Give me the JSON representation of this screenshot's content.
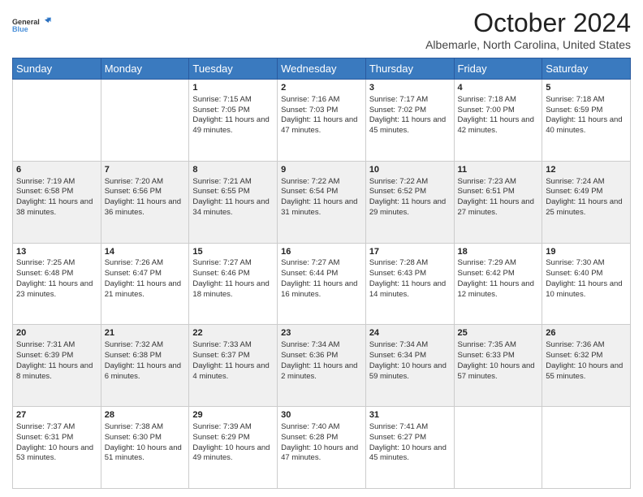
{
  "logo": {
    "line1": "General",
    "line2": "Blue"
  },
  "title": "October 2024",
  "location": "Albemarle, North Carolina, United States",
  "weekdays": [
    "Sunday",
    "Monday",
    "Tuesday",
    "Wednesday",
    "Thursday",
    "Friday",
    "Saturday"
  ],
  "weeks": [
    [
      {
        "day": "",
        "sunrise": "",
        "sunset": "",
        "daylight": ""
      },
      {
        "day": "",
        "sunrise": "",
        "sunset": "",
        "daylight": ""
      },
      {
        "day": "1",
        "sunrise": "Sunrise: 7:15 AM",
        "sunset": "Sunset: 7:05 PM",
        "daylight": "Daylight: 11 hours and 49 minutes."
      },
      {
        "day": "2",
        "sunrise": "Sunrise: 7:16 AM",
        "sunset": "Sunset: 7:03 PM",
        "daylight": "Daylight: 11 hours and 47 minutes."
      },
      {
        "day": "3",
        "sunrise": "Sunrise: 7:17 AM",
        "sunset": "Sunset: 7:02 PM",
        "daylight": "Daylight: 11 hours and 45 minutes."
      },
      {
        "day": "4",
        "sunrise": "Sunrise: 7:18 AM",
        "sunset": "Sunset: 7:00 PM",
        "daylight": "Daylight: 11 hours and 42 minutes."
      },
      {
        "day": "5",
        "sunrise": "Sunrise: 7:18 AM",
        "sunset": "Sunset: 6:59 PM",
        "daylight": "Daylight: 11 hours and 40 minutes."
      }
    ],
    [
      {
        "day": "6",
        "sunrise": "Sunrise: 7:19 AM",
        "sunset": "Sunset: 6:58 PM",
        "daylight": "Daylight: 11 hours and 38 minutes."
      },
      {
        "day": "7",
        "sunrise": "Sunrise: 7:20 AM",
        "sunset": "Sunset: 6:56 PM",
        "daylight": "Daylight: 11 hours and 36 minutes."
      },
      {
        "day": "8",
        "sunrise": "Sunrise: 7:21 AM",
        "sunset": "Sunset: 6:55 PM",
        "daylight": "Daylight: 11 hours and 34 minutes."
      },
      {
        "day": "9",
        "sunrise": "Sunrise: 7:22 AM",
        "sunset": "Sunset: 6:54 PM",
        "daylight": "Daylight: 11 hours and 31 minutes."
      },
      {
        "day": "10",
        "sunrise": "Sunrise: 7:22 AM",
        "sunset": "Sunset: 6:52 PM",
        "daylight": "Daylight: 11 hours and 29 minutes."
      },
      {
        "day": "11",
        "sunrise": "Sunrise: 7:23 AM",
        "sunset": "Sunset: 6:51 PM",
        "daylight": "Daylight: 11 hours and 27 minutes."
      },
      {
        "day": "12",
        "sunrise": "Sunrise: 7:24 AM",
        "sunset": "Sunset: 6:49 PM",
        "daylight": "Daylight: 11 hours and 25 minutes."
      }
    ],
    [
      {
        "day": "13",
        "sunrise": "Sunrise: 7:25 AM",
        "sunset": "Sunset: 6:48 PM",
        "daylight": "Daylight: 11 hours and 23 minutes."
      },
      {
        "day": "14",
        "sunrise": "Sunrise: 7:26 AM",
        "sunset": "Sunset: 6:47 PM",
        "daylight": "Daylight: 11 hours and 21 minutes."
      },
      {
        "day": "15",
        "sunrise": "Sunrise: 7:27 AM",
        "sunset": "Sunset: 6:46 PM",
        "daylight": "Daylight: 11 hours and 18 minutes."
      },
      {
        "day": "16",
        "sunrise": "Sunrise: 7:27 AM",
        "sunset": "Sunset: 6:44 PM",
        "daylight": "Daylight: 11 hours and 16 minutes."
      },
      {
        "day": "17",
        "sunrise": "Sunrise: 7:28 AM",
        "sunset": "Sunset: 6:43 PM",
        "daylight": "Daylight: 11 hours and 14 minutes."
      },
      {
        "day": "18",
        "sunrise": "Sunrise: 7:29 AM",
        "sunset": "Sunset: 6:42 PM",
        "daylight": "Daylight: 11 hours and 12 minutes."
      },
      {
        "day": "19",
        "sunrise": "Sunrise: 7:30 AM",
        "sunset": "Sunset: 6:40 PM",
        "daylight": "Daylight: 11 hours and 10 minutes."
      }
    ],
    [
      {
        "day": "20",
        "sunrise": "Sunrise: 7:31 AM",
        "sunset": "Sunset: 6:39 PM",
        "daylight": "Daylight: 11 hours and 8 minutes."
      },
      {
        "day": "21",
        "sunrise": "Sunrise: 7:32 AM",
        "sunset": "Sunset: 6:38 PM",
        "daylight": "Daylight: 11 hours and 6 minutes."
      },
      {
        "day": "22",
        "sunrise": "Sunrise: 7:33 AM",
        "sunset": "Sunset: 6:37 PM",
        "daylight": "Daylight: 11 hours and 4 minutes."
      },
      {
        "day": "23",
        "sunrise": "Sunrise: 7:34 AM",
        "sunset": "Sunset: 6:36 PM",
        "daylight": "Daylight: 11 hours and 2 minutes."
      },
      {
        "day": "24",
        "sunrise": "Sunrise: 7:34 AM",
        "sunset": "Sunset: 6:34 PM",
        "daylight": "Daylight: 10 hours and 59 minutes."
      },
      {
        "day": "25",
        "sunrise": "Sunrise: 7:35 AM",
        "sunset": "Sunset: 6:33 PM",
        "daylight": "Daylight: 10 hours and 57 minutes."
      },
      {
        "day": "26",
        "sunrise": "Sunrise: 7:36 AM",
        "sunset": "Sunset: 6:32 PM",
        "daylight": "Daylight: 10 hours and 55 minutes."
      }
    ],
    [
      {
        "day": "27",
        "sunrise": "Sunrise: 7:37 AM",
        "sunset": "Sunset: 6:31 PM",
        "daylight": "Daylight: 10 hours and 53 minutes."
      },
      {
        "day": "28",
        "sunrise": "Sunrise: 7:38 AM",
        "sunset": "Sunset: 6:30 PM",
        "daylight": "Daylight: 10 hours and 51 minutes."
      },
      {
        "day": "29",
        "sunrise": "Sunrise: 7:39 AM",
        "sunset": "Sunset: 6:29 PM",
        "daylight": "Daylight: 10 hours and 49 minutes."
      },
      {
        "day": "30",
        "sunrise": "Sunrise: 7:40 AM",
        "sunset": "Sunset: 6:28 PM",
        "daylight": "Daylight: 10 hours and 47 minutes."
      },
      {
        "day": "31",
        "sunrise": "Sunrise: 7:41 AM",
        "sunset": "Sunset: 6:27 PM",
        "daylight": "Daylight: 10 hours and 45 minutes."
      },
      {
        "day": "",
        "sunrise": "",
        "sunset": "",
        "daylight": ""
      },
      {
        "day": "",
        "sunrise": "",
        "sunset": "",
        "daylight": ""
      }
    ]
  ]
}
